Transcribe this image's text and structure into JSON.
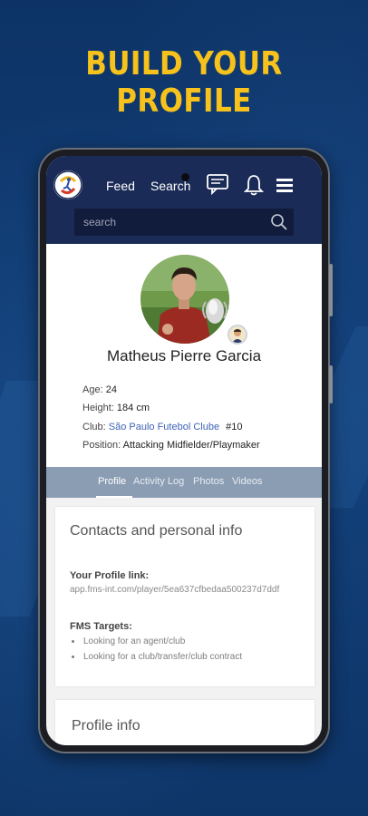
{
  "promo": {
    "headline": "BUILD YOUR PROFILE"
  },
  "app": {
    "nav": {
      "feed": "Feed",
      "search": "Search"
    },
    "icons": {
      "logo": "app-logo",
      "messages": "chat-icon",
      "notifications": "bell-icon",
      "menu": "hamburger-menu-icon",
      "search": "search-icon"
    },
    "search": {
      "placeholder": "search",
      "value": ""
    },
    "colors": {
      "topbar": "#1b2b57",
      "accent": "#3e63b6",
      "tabs_bg": "#8b9db3",
      "headline": "#f6c21b"
    }
  },
  "profile": {
    "name": "Matheus Pierre Garcia",
    "age_label": "Age:",
    "age": "24",
    "height_label": "Height:",
    "height": "184 cm",
    "club_label": "Club:",
    "club": "São Paulo Futebol Clube",
    "number": "#10",
    "position_label": "Position:",
    "position": "Attacking Midfielder/Playmaker"
  },
  "tabs": [
    {
      "label": "Profile",
      "active": true
    },
    {
      "label": "Activity Log",
      "active": false
    },
    {
      "label": "Photos",
      "active": false
    },
    {
      "label": "Videos",
      "active": false
    }
  ],
  "contacts": {
    "title": "Contacts and personal info",
    "profile_link_label": "Your Profile link:",
    "profile_link": "app.fms-int.com/player/5ea637cfbedaa500237d7ddf",
    "targets_label": "FMS Targets:",
    "targets": [
      "Looking for an agent/club",
      "Looking for a club/transfer/club contract"
    ]
  },
  "profile_info": {
    "title": "Profile info"
  }
}
